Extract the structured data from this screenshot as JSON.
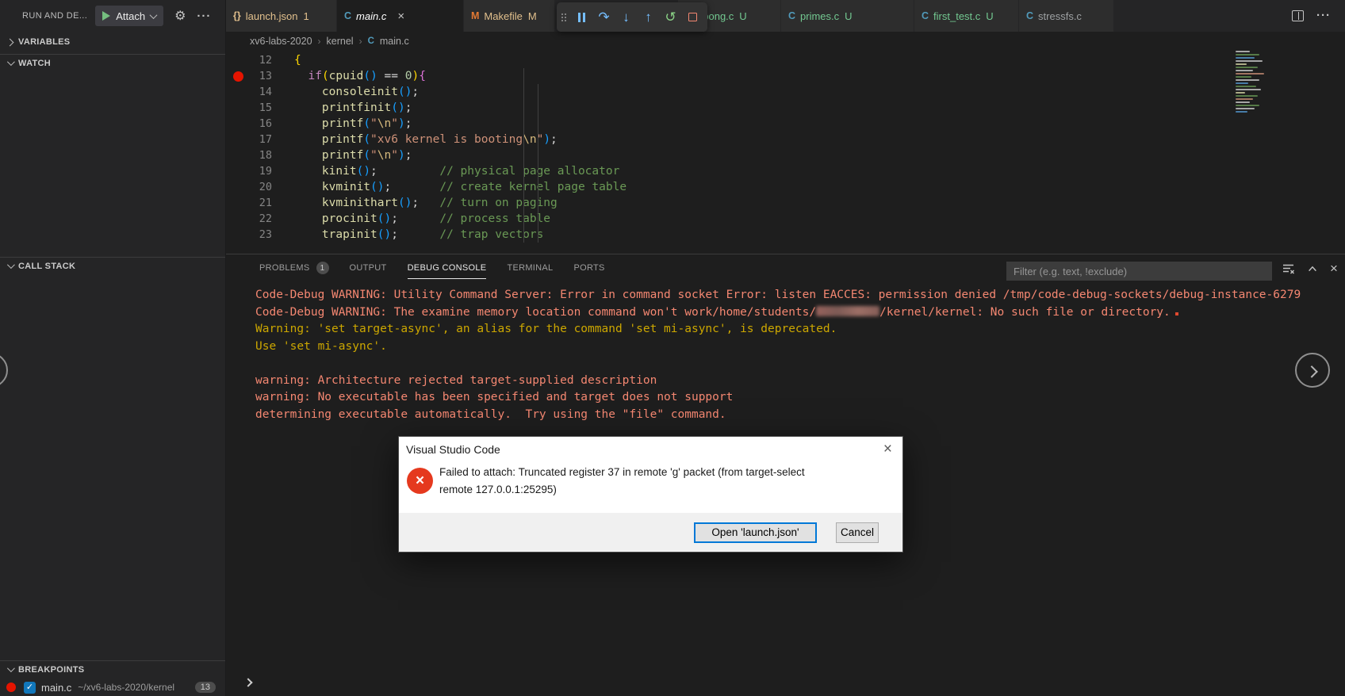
{
  "colors": {
    "accent": "#0078d7",
    "console_error": "#f48771",
    "console_warning": "#cca700",
    "git_modified": "#e2c08d",
    "git_untracked": "#73c991",
    "breakpoint_red": "#e51400",
    "c_icon_blue": "#519aba",
    "makefile_icon_orange": "#e37933"
  },
  "sidebar": {
    "panel_title": "RUN AND DE...",
    "attach_label": "Attach",
    "sections": [
      {
        "label": "VARIABLES",
        "collapsed": true
      },
      {
        "label": "WATCH",
        "collapsed": false
      },
      {
        "label": "CALL STACK",
        "collapsed": false
      },
      {
        "label": "BREAKPOINTS",
        "collapsed": false
      }
    ],
    "breakpoint_item": {
      "file": "main.c",
      "path": "~/xv6-labs-2020/kernel",
      "line_badge": "13"
    }
  },
  "editor_tabs": [
    {
      "label": "launch.json",
      "badge": "1",
      "icon": "braces",
      "state": "modified"
    },
    {
      "label": "main.c",
      "badge": "",
      "icon": "c-lang",
      "state": "active",
      "preview": true,
      "closable": true
    },
    {
      "label": "Makefile",
      "badge": "M",
      "icon": "makefile",
      "state": "modified"
    },
    {
      "label": "gpong.c",
      "badge": "U",
      "icon": "c-lang",
      "state": "untracked"
    },
    {
      "label": "primes.c",
      "badge": "U",
      "icon": "c-lang",
      "state": "untracked"
    },
    {
      "label": "first_test.c",
      "badge": "U",
      "icon": "c-lang",
      "state": "untracked"
    },
    {
      "label": "stressfs.c",
      "badge": "",
      "icon": "c-lang",
      "state": "normal"
    }
  ],
  "debug_toolbar_icons": [
    "drag-grip",
    "pause",
    "step-over",
    "step-into",
    "step-out",
    "restart",
    "stop"
  ],
  "breadcrumb": [
    "xv6-labs-2020",
    "kernel",
    "main.c"
  ],
  "code": {
    "breakpoint_line": 13,
    "lines": [
      {
        "num": 12,
        "tokens": [
          [
            "{",
            "b1"
          ]
        ]
      },
      {
        "num": 13,
        "tokens": [
          [
            "  ",
            ""
          ],
          [
            "if",
            "kw"
          ],
          [
            "(",
            "b1"
          ],
          [
            "cpuid",
            "fn"
          ],
          [
            "(",
            "b3"
          ],
          [
            ")",
            "b3"
          ],
          [
            " ",
            ""
          ],
          [
            "==",
            "op"
          ],
          [
            " ",
            ""
          ],
          [
            "0",
            "num"
          ],
          [
            ")",
            "b1"
          ],
          [
            "{",
            "b2"
          ]
        ]
      },
      {
        "num": 14,
        "tokens": [
          [
            "    ",
            ""
          ],
          [
            "consoleinit",
            "fn"
          ],
          [
            "(",
            "b3"
          ],
          [
            ")",
            "b3"
          ],
          [
            ";",
            "def"
          ]
        ]
      },
      {
        "num": 15,
        "tokens": [
          [
            "    ",
            ""
          ],
          [
            "printfinit",
            "fn"
          ],
          [
            "(",
            "b3"
          ],
          [
            ")",
            "b3"
          ],
          [
            ";",
            "def"
          ]
        ]
      },
      {
        "num": 16,
        "tokens": [
          [
            "    ",
            ""
          ],
          [
            "printf",
            "fn"
          ],
          [
            "(",
            "b3"
          ],
          [
            "\"",
            "str"
          ],
          [
            "\\n",
            "esc"
          ],
          [
            "\"",
            "str"
          ],
          [
            ")",
            "b3"
          ],
          [
            ";",
            "def"
          ]
        ]
      },
      {
        "num": 17,
        "tokens": [
          [
            "    ",
            ""
          ],
          [
            "printf",
            "fn"
          ],
          [
            "(",
            "b3"
          ],
          [
            "\"xv6 kernel is booting",
            "str"
          ],
          [
            "\\n",
            "esc"
          ],
          [
            "\"",
            "str"
          ],
          [
            ")",
            "b3"
          ],
          [
            ";",
            "def"
          ]
        ]
      },
      {
        "num": 18,
        "tokens": [
          [
            "    ",
            ""
          ],
          [
            "printf",
            "fn"
          ],
          [
            "(",
            "b3"
          ],
          [
            "\"",
            "str"
          ],
          [
            "\\n",
            "esc"
          ],
          [
            "\"",
            "str"
          ],
          [
            ")",
            "b3"
          ],
          [
            ";",
            "def"
          ]
        ]
      },
      {
        "num": 19,
        "tokens": [
          [
            "    ",
            ""
          ],
          [
            "kinit",
            "fn"
          ],
          [
            "(",
            "b3"
          ],
          [
            ")",
            "b3"
          ],
          [
            ";",
            "def"
          ],
          [
            "         ",
            ""
          ],
          [
            "// physical page allocator",
            "cmt"
          ]
        ]
      },
      {
        "num": 20,
        "tokens": [
          [
            "    ",
            ""
          ],
          [
            "kvminit",
            "fn"
          ],
          [
            "(",
            "b3"
          ],
          [
            ")",
            "b3"
          ],
          [
            ";",
            "def"
          ],
          [
            "       ",
            ""
          ],
          [
            "// create kernel page table",
            "cmt"
          ]
        ]
      },
      {
        "num": 21,
        "tokens": [
          [
            "    ",
            ""
          ],
          [
            "kvminithart",
            "fn"
          ],
          [
            "(",
            "b3"
          ],
          [
            ")",
            "b3"
          ],
          [
            ";",
            "def"
          ],
          [
            "   ",
            ""
          ],
          [
            "// turn on paging",
            "cmt"
          ]
        ]
      },
      {
        "num": 22,
        "tokens": [
          [
            "    ",
            ""
          ],
          [
            "procinit",
            "fn"
          ],
          [
            "(",
            "b3"
          ],
          [
            ")",
            "b3"
          ],
          [
            ";",
            "def"
          ],
          [
            "      ",
            ""
          ],
          [
            "// process table",
            "cmt"
          ]
        ]
      },
      {
        "num": 23,
        "tokens": [
          [
            "    ",
            ""
          ],
          [
            "trapinit",
            "fn"
          ],
          [
            "(",
            "b3"
          ],
          [
            ")",
            "b3"
          ],
          [
            ";",
            "def"
          ],
          [
            "      ",
            ""
          ],
          [
            "// trap vectors",
            "cmt"
          ]
        ]
      }
    ]
  },
  "panel": {
    "tabs": [
      {
        "label": "PROBLEMS",
        "badge": "1"
      },
      {
        "label": "OUTPUT",
        "badge": ""
      },
      {
        "label": "DEBUG CONSOLE",
        "badge": "",
        "active": true
      },
      {
        "label": "TERMINAL",
        "badge": ""
      },
      {
        "label": "PORTS",
        "badge": ""
      }
    ],
    "filter_placeholder": "Filter (e.g. text, !exclude)",
    "console_lines": [
      {
        "color": "red",
        "parts": [
          {
            "text": "Code-Debug WARNING: Utility Command Server: Error in command socket Error: listen EACCES: permission denied /tmp/code-debug-sockets/debug-instance-6279"
          }
        ]
      },
      {
        "color": "red",
        "parts": [
          {
            "text": "Code-Debug WARNING: The examine memory location command won't work/home/students/"
          },
          {
            "redacted": true
          },
          {
            "text": "/kernel/kernel: No such file or directory."
          }
        ]
      },
      {
        "color": "yellow",
        "parts": [
          {
            "text": "Warning: 'set target-async', an alias for the command 'set mi-async', is deprecated."
          }
        ]
      },
      {
        "color": "yellow",
        "parts": [
          {
            "text": "Use 'set mi-async'."
          }
        ]
      },
      {
        "color": "red",
        "parts": [
          {
            "text": ""
          }
        ]
      },
      {
        "color": "red",
        "parts": [
          {
            "text": "warning: Architecture rejected target-supplied description"
          }
        ]
      },
      {
        "color": "red",
        "parts": [
          {
            "text": "warning: No executable has been specified and target does not support"
          }
        ]
      },
      {
        "color": "red",
        "parts": [
          {
            "text": "determining executable automatically.  Try using the \"file\" command."
          }
        ]
      }
    ]
  },
  "dialog": {
    "title": "Visual Studio Code",
    "message": "Failed to attach: Truncated register 37 in remote 'g' packet (from target-select remote 127.0.0.1:25295)",
    "message_lines": [
      "Failed to attach: Truncated register 37 in remote 'g' packet (from target-select",
      "remote 127.0.0.1:25295)"
    ],
    "primary_button": "Open 'launch.json'",
    "cancel_button": "Cancel"
  }
}
